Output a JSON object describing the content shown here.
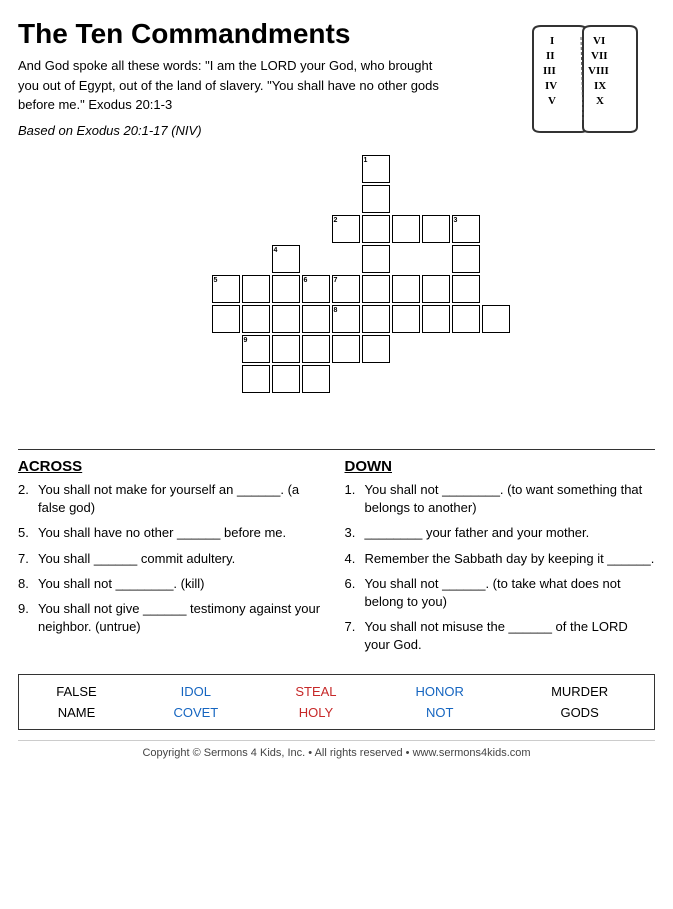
{
  "title": "The Ten Commandments",
  "intro": {
    "text": "And God spoke all these words: \"I am the LORD your God, who brought you out of Egypt, out of the land of slavery. \"You shall have no other gods before me.\" Exodus 20:1-3",
    "based_on": "Based on Exodus 20:1-17 (NIV)"
  },
  "across_header": "ACROSS",
  "down_header": "DOWN",
  "across_clues": [
    {
      "num": "2.",
      "text": "You shall not make for yourself an ______. (a false god)"
    },
    {
      "num": "5.",
      "text": "You shall have no other ______ before me."
    },
    {
      "num": "7.",
      "text": "You shall ______ commit adultery."
    },
    {
      "num": "8.",
      "text": "You shall not ________. (kill)"
    },
    {
      "num": "9.",
      "text": "You shall not give ______ testimony against your neighbor. (untrue)"
    }
  ],
  "down_clues": [
    {
      "num": "1.",
      "text": "You shall not ________. (to want something that belongs to another)"
    },
    {
      "num": "3.",
      "text": "________ your father and your mother."
    },
    {
      "num": "4.",
      "text": "Remember the Sabbath day by keeping it ______."
    },
    {
      "num": "6.",
      "text": "You shall not ______. (to take what does not belong to you)"
    },
    {
      "num": "7.",
      "text": "You shall not misuse the ______ of the LORD your God."
    }
  ],
  "word_bank": {
    "rows": [
      [
        "FALSE",
        "IDOL",
        "STEAL",
        "HONOR",
        "MURDER"
      ],
      [
        "NAME",
        "COVET",
        "HOLY",
        "NOT",
        "GODS"
      ]
    ],
    "colors": [
      "black",
      "blue",
      "red",
      "blue",
      "black"
    ]
  },
  "copyright": "Copyright © Sermons 4 Kids, Inc. • All rights reserved • www.sermons4kids.com"
}
